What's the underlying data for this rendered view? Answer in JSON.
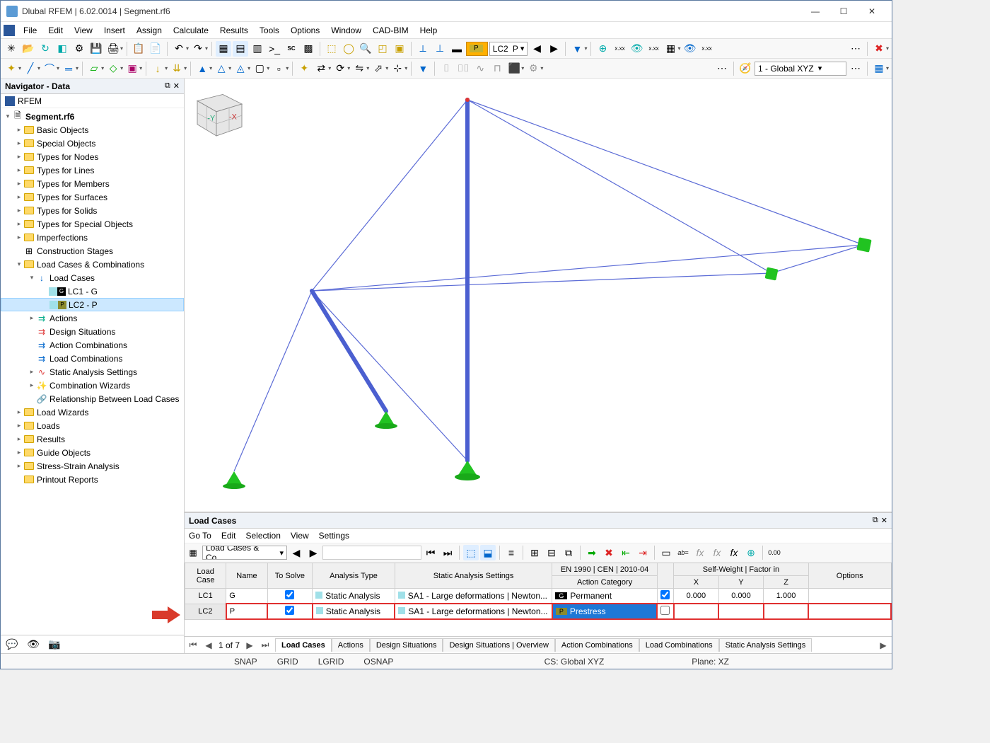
{
  "titlebar": {
    "title": "Dlubal RFEM | 6.02.0014 | Segment.rf6"
  },
  "menu": {
    "items": [
      "File",
      "Edit",
      "View",
      "Insert",
      "Assign",
      "Calculate",
      "Results",
      "Tools",
      "Options",
      "Window",
      "CAD-BIM",
      "Help"
    ]
  },
  "toolbar1": {
    "lc_selector": {
      "badge": "P",
      "code": "LC2",
      "name": "P"
    },
    "cs_selector": "1 - Global XYZ"
  },
  "navigator": {
    "title": "Navigator - Data",
    "root": "RFEM",
    "project": "Segment.rf6",
    "items": [
      "Basic Objects",
      "Special Objects",
      "Types for Nodes",
      "Types for Lines",
      "Types for Members",
      "Types for Surfaces",
      "Types for Solids",
      "Types for Special Objects",
      "Imperfections"
    ],
    "construction_stages": "Construction Stages",
    "lcc": "Load Cases & Combinations",
    "load_cases": "Load Cases",
    "lc1": "LC1 - G",
    "lc2": "LC2 - P",
    "lc_children": [
      "Actions",
      "Design Situations",
      "Action Combinations",
      "Load Combinations",
      "Static Analysis Settings",
      "Combination Wizards",
      "Relationship Between Load Cases"
    ],
    "rest": [
      "Load Wizards",
      "Loads",
      "Results",
      "Guide Objects",
      "Stress-Strain Analysis",
      "Printout Reports"
    ]
  },
  "lc_panel": {
    "title": "Load Cases",
    "menu": [
      "Go To",
      "Edit",
      "Selection",
      "View",
      "Settings"
    ],
    "combo": "Load Cases & Co...",
    "headers": {
      "load_case": "Load\nCase",
      "name": "Name",
      "to_solve": "To Solve",
      "analysis_type": "Analysis Type",
      "static_settings": "Static Analysis Settings",
      "action_group": "EN 1990 | CEN | 2010-04",
      "action_category": "Action Category",
      "sw_group": "Self-Weight | Factor in",
      "x": "X",
      "y": "Y",
      "z": "Z",
      "options": "Options"
    },
    "rows": [
      {
        "case": "LC1",
        "name": "G",
        "solve": true,
        "atype": "Static Analysis",
        "sas": "SA1 - Large deformations | Newton...",
        "ac_badge": "G",
        "ac": "Permanent",
        "sw": true,
        "x": "0.000",
        "y": "0.000",
        "z": "1.000",
        "opts": ""
      },
      {
        "case": "LC2",
        "name": "P",
        "solve": true,
        "atype": "Static Analysis",
        "sas": "SA1 - Large deformations | Newton...",
        "ac_badge": "P",
        "ac": "Prestress",
        "sw": false,
        "x": "",
        "y": "",
        "z": "",
        "opts": ""
      }
    ],
    "pager": {
      "pos": "1 of 7",
      "tabs": [
        "Load Cases",
        "Actions",
        "Design Situations",
        "Design Situations | Overview",
        "Action Combinations",
        "Load Combinations",
        "Static Analysis Settings"
      ]
    }
  },
  "status": {
    "snap": "SNAP",
    "grid": "GRID",
    "lgrid": "LGRID",
    "osnap": "OSNAP",
    "cs": "CS: Global XYZ",
    "plane": "Plane: XZ"
  }
}
